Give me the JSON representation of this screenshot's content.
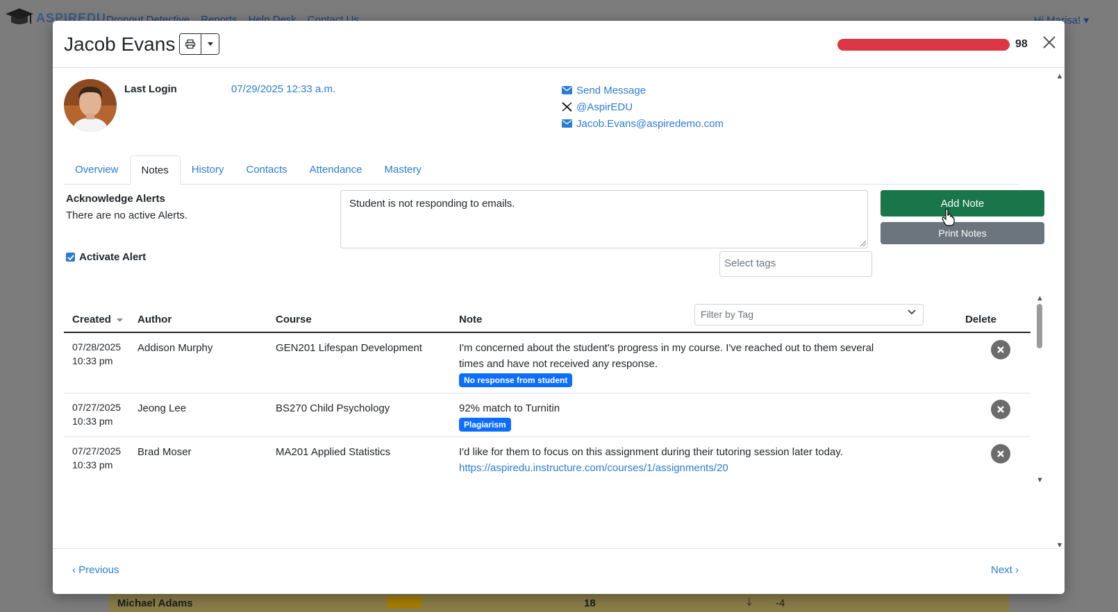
{
  "background": {
    "brand": "ASPIREDU",
    "nav_links": [
      "Dropout Detective",
      "Reports",
      "Help Desk",
      "Contact Us"
    ],
    "user_greeting": "Hi Marisa!",
    "visible_row": {
      "name": "Michael Adams",
      "value": "18",
      "change": "-4"
    }
  },
  "modal": {
    "student_name": "Jacob Evans",
    "risk_score": "98",
    "risk_color": "#dc3545",
    "last_login_label": "Last Login",
    "last_login_value": "07/29/2025 12:33 a.m.",
    "contacts": {
      "send_message": "Send Message",
      "twitter": "@AspirEDU",
      "email": "Jacob.Evans@aspiredemo.com"
    },
    "tabs": [
      {
        "label": "Overview",
        "active": false
      },
      {
        "label": "Notes",
        "active": true
      },
      {
        "label": "History",
        "active": false
      },
      {
        "label": "Contacts",
        "active": false
      },
      {
        "label": "Attendance",
        "active": false
      },
      {
        "label": "Mastery",
        "active": false
      }
    ],
    "alerts": {
      "title": "Acknowledge Alerts",
      "text": "There are no active Alerts.",
      "activate_label": "Activate Alert",
      "activate_checked": true
    },
    "note_input": {
      "value": "Student is not responding to emails.",
      "tags_placeholder": "Select tags"
    },
    "buttons": {
      "add_note": "Add Note",
      "print_notes": "Print Notes"
    },
    "table": {
      "headers": {
        "created": "Created",
        "author": "Author",
        "course": "Course",
        "note": "Note",
        "delete": "Delete"
      },
      "filter_placeholder": "Filter by Tag",
      "rows": [
        {
          "date": "07/28/2025",
          "time": "10:33 pm",
          "author": "Addison Murphy",
          "course": "GEN201 Lifespan Development",
          "note_line1": "I'm concerned about the student's progress in my course. I've reached out to them several",
          "note_line2": "times and have not received any response.",
          "tag": "No response from student"
        },
        {
          "date": "07/27/2025",
          "time": "10:33 pm",
          "author": "Jeong Lee",
          "course": "BS270 Child Psychology",
          "note_line1": "92% match to Turnitin",
          "tag": "Plagiarism"
        },
        {
          "date": "07/27/2025",
          "time": "10:33 pm",
          "author": "Brad Moser",
          "course": "MA201 Applied Statistics",
          "note_line1": "I'd like for them to focus on this assignment during their tutoring session later today.",
          "link": "https://aspiredu.instructure.com/courses/1/assignments/20"
        }
      ]
    },
    "footer": {
      "previous": "‹ Previous",
      "next": "Next ›"
    }
  }
}
